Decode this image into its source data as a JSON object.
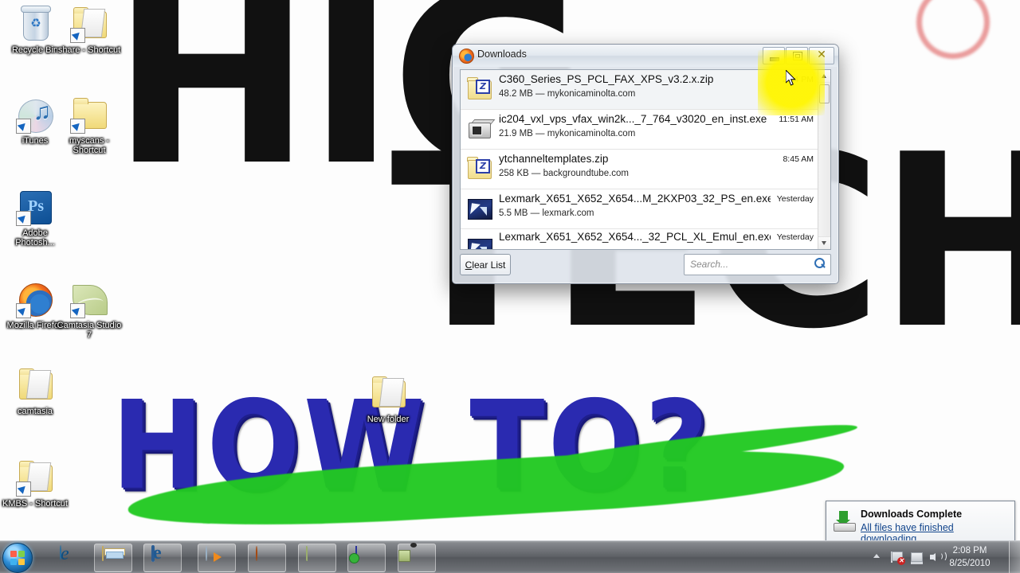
{
  "desktop": {
    "wallpaper": {
      "headline_line1": "HIG",
      "headline_line2": "TECH",
      "subhead": "HOW TO?",
      "accent_color": "#22c922",
      "headline_color": "#111111",
      "subhead_color": "#2a2ab0"
    },
    "icons": [
      {
        "label": "Recycle Bin",
        "icon": "recycle-bin-icon",
        "shortcut": false
      },
      {
        "label": "share - Shortcut",
        "icon": "folder-open-icon",
        "shortcut": true
      },
      {
        "label": "iTunes",
        "icon": "itunes-icon",
        "shortcut": true
      },
      {
        "label": "myscans - Shortcut",
        "icon": "folder-icon",
        "shortcut": true
      },
      {
        "label": "Adobe Photosh...",
        "icon": "photoshop-icon",
        "shortcut": true
      },
      {
        "label": "Mozilla Firefox",
        "icon": "firefox-icon",
        "shortcut": true
      },
      {
        "label": "Camtasia Studio 7",
        "icon": "camtasia-icon",
        "shortcut": true
      },
      {
        "label": "camtasia",
        "icon": "folder-open-icon",
        "shortcut": false
      },
      {
        "label": "KMBS - Shortcut",
        "icon": "folder-open-icon",
        "shortcut": true
      },
      {
        "label": "New folder",
        "icon": "folder-icon",
        "shortcut": false
      }
    ]
  },
  "downloads_window": {
    "title": "Downloads",
    "app_icon": "firefox-icon",
    "buttons": {
      "minimize": "minimize-icon",
      "restore": "restore-icon",
      "close": "close-icon"
    },
    "items": [
      {
        "name": "C360_Series_PS_PCL_FAX_XPS_v3.2.x.zip",
        "size": "48.2 MB",
        "source": "mykonicaminolta.com",
        "meta": "48.2 MB — mykonicaminolta.com",
        "time": "2:04 PM",
        "icon": "zip-file-icon",
        "selected": true
      },
      {
        "name": "ic204_vxl_vps_vfax_win2k..._7_764_v3020_en_inst.exe",
        "size": "21.9 MB",
        "source": "mykonicaminolta.com",
        "meta": "21.9 MB — mykonicaminolta.com",
        "time": "11:51 AM",
        "icon": "exe-file-icon",
        "selected": false
      },
      {
        "name": "ytchanneltemplates.zip",
        "size": "258 KB",
        "source": "backgroundtube.com",
        "meta": "258 KB — backgroundtube.com",
        "time": "8:45 AM",
        "icon": "zip-file-icon",
        "selected": false
      },
      {
        "name": "Lexmark_X651_X652_X654...M_2KXP03_32_PS_en.exe",
        "size": "5.5 MB",
        "source": "lexmark.com",
        "meta": "5.5 MB — lexmark.com",
        "time": "Yesterday",
        "icon": "lexmark-file-icon",
        "selected": false
      },
      {
        "name": "Lexmark_X651_X652_X654..._32_PCL_XL_Emul_en.exe",
        "size": "",
        "source": "",
        "meta": "",
        "time": "Yesterday",
        "icon": "lexmark-file-icon",
        "selected": false
      }
    ],
    "clear_list_label": "Clear List",
    "clear_list_accel": "C",
    "clear_list_rest": "lear List",
    "search_placeholder": "Search...",
    "search_value": "",
    "search_icon": "search-icon"
  },
  "notification": {
    "title": "Downloads Complete",
    "link": "All files have finished downloading.",
    "icon": "download-complete-icon",
    "link_color": "#12458c"
  },
  "taskbar": {
    "start_label": "Start",
    "start_icon": "windows-start-orb-icon",
    "buttons": [
      {
        "name": "internet-explorer",
        "icon": "internet-explorer-icon",
        "framed": false
      },
      {
        "name": "windows-explorer",
        "icon": "folder-explorer-icon",
        "framed": true
      },
      {
        "name": "outlook-express",
        "icon": "outlook-icon",
        "framed": true
      },
      {
        "name": "windows-media-player",
        "icon": "media-player-icon",
        "framed": true
      },
      {
        "name": "mozilla-firefox",
        "icon": "firefox-icon",
        "framed": true
      },
      {
        "name": "camtasia-studio",
        "icon": "camtasia-icon",
        "framed": true
      },
      {
        "name": "kmbs-app",
        "icon": "kmbs-icon",
        "framed": true
      },
      {
        "name": "camera-app",
        "icon": "camera-icon",
        "framed": true
      }
    ],
    "tray": {
      "expand_icon": "show-hidden-icons-chevron",
      "action_center_icon": "flag-warning-icon",
      "network_icon": "network-icon",
      "volume_icon": "volume-icon",
      "time": "2:08 PM",
      "date": "8/25/2010",
      "show_desktop": "show-desktop-button"
    }
  }
}
